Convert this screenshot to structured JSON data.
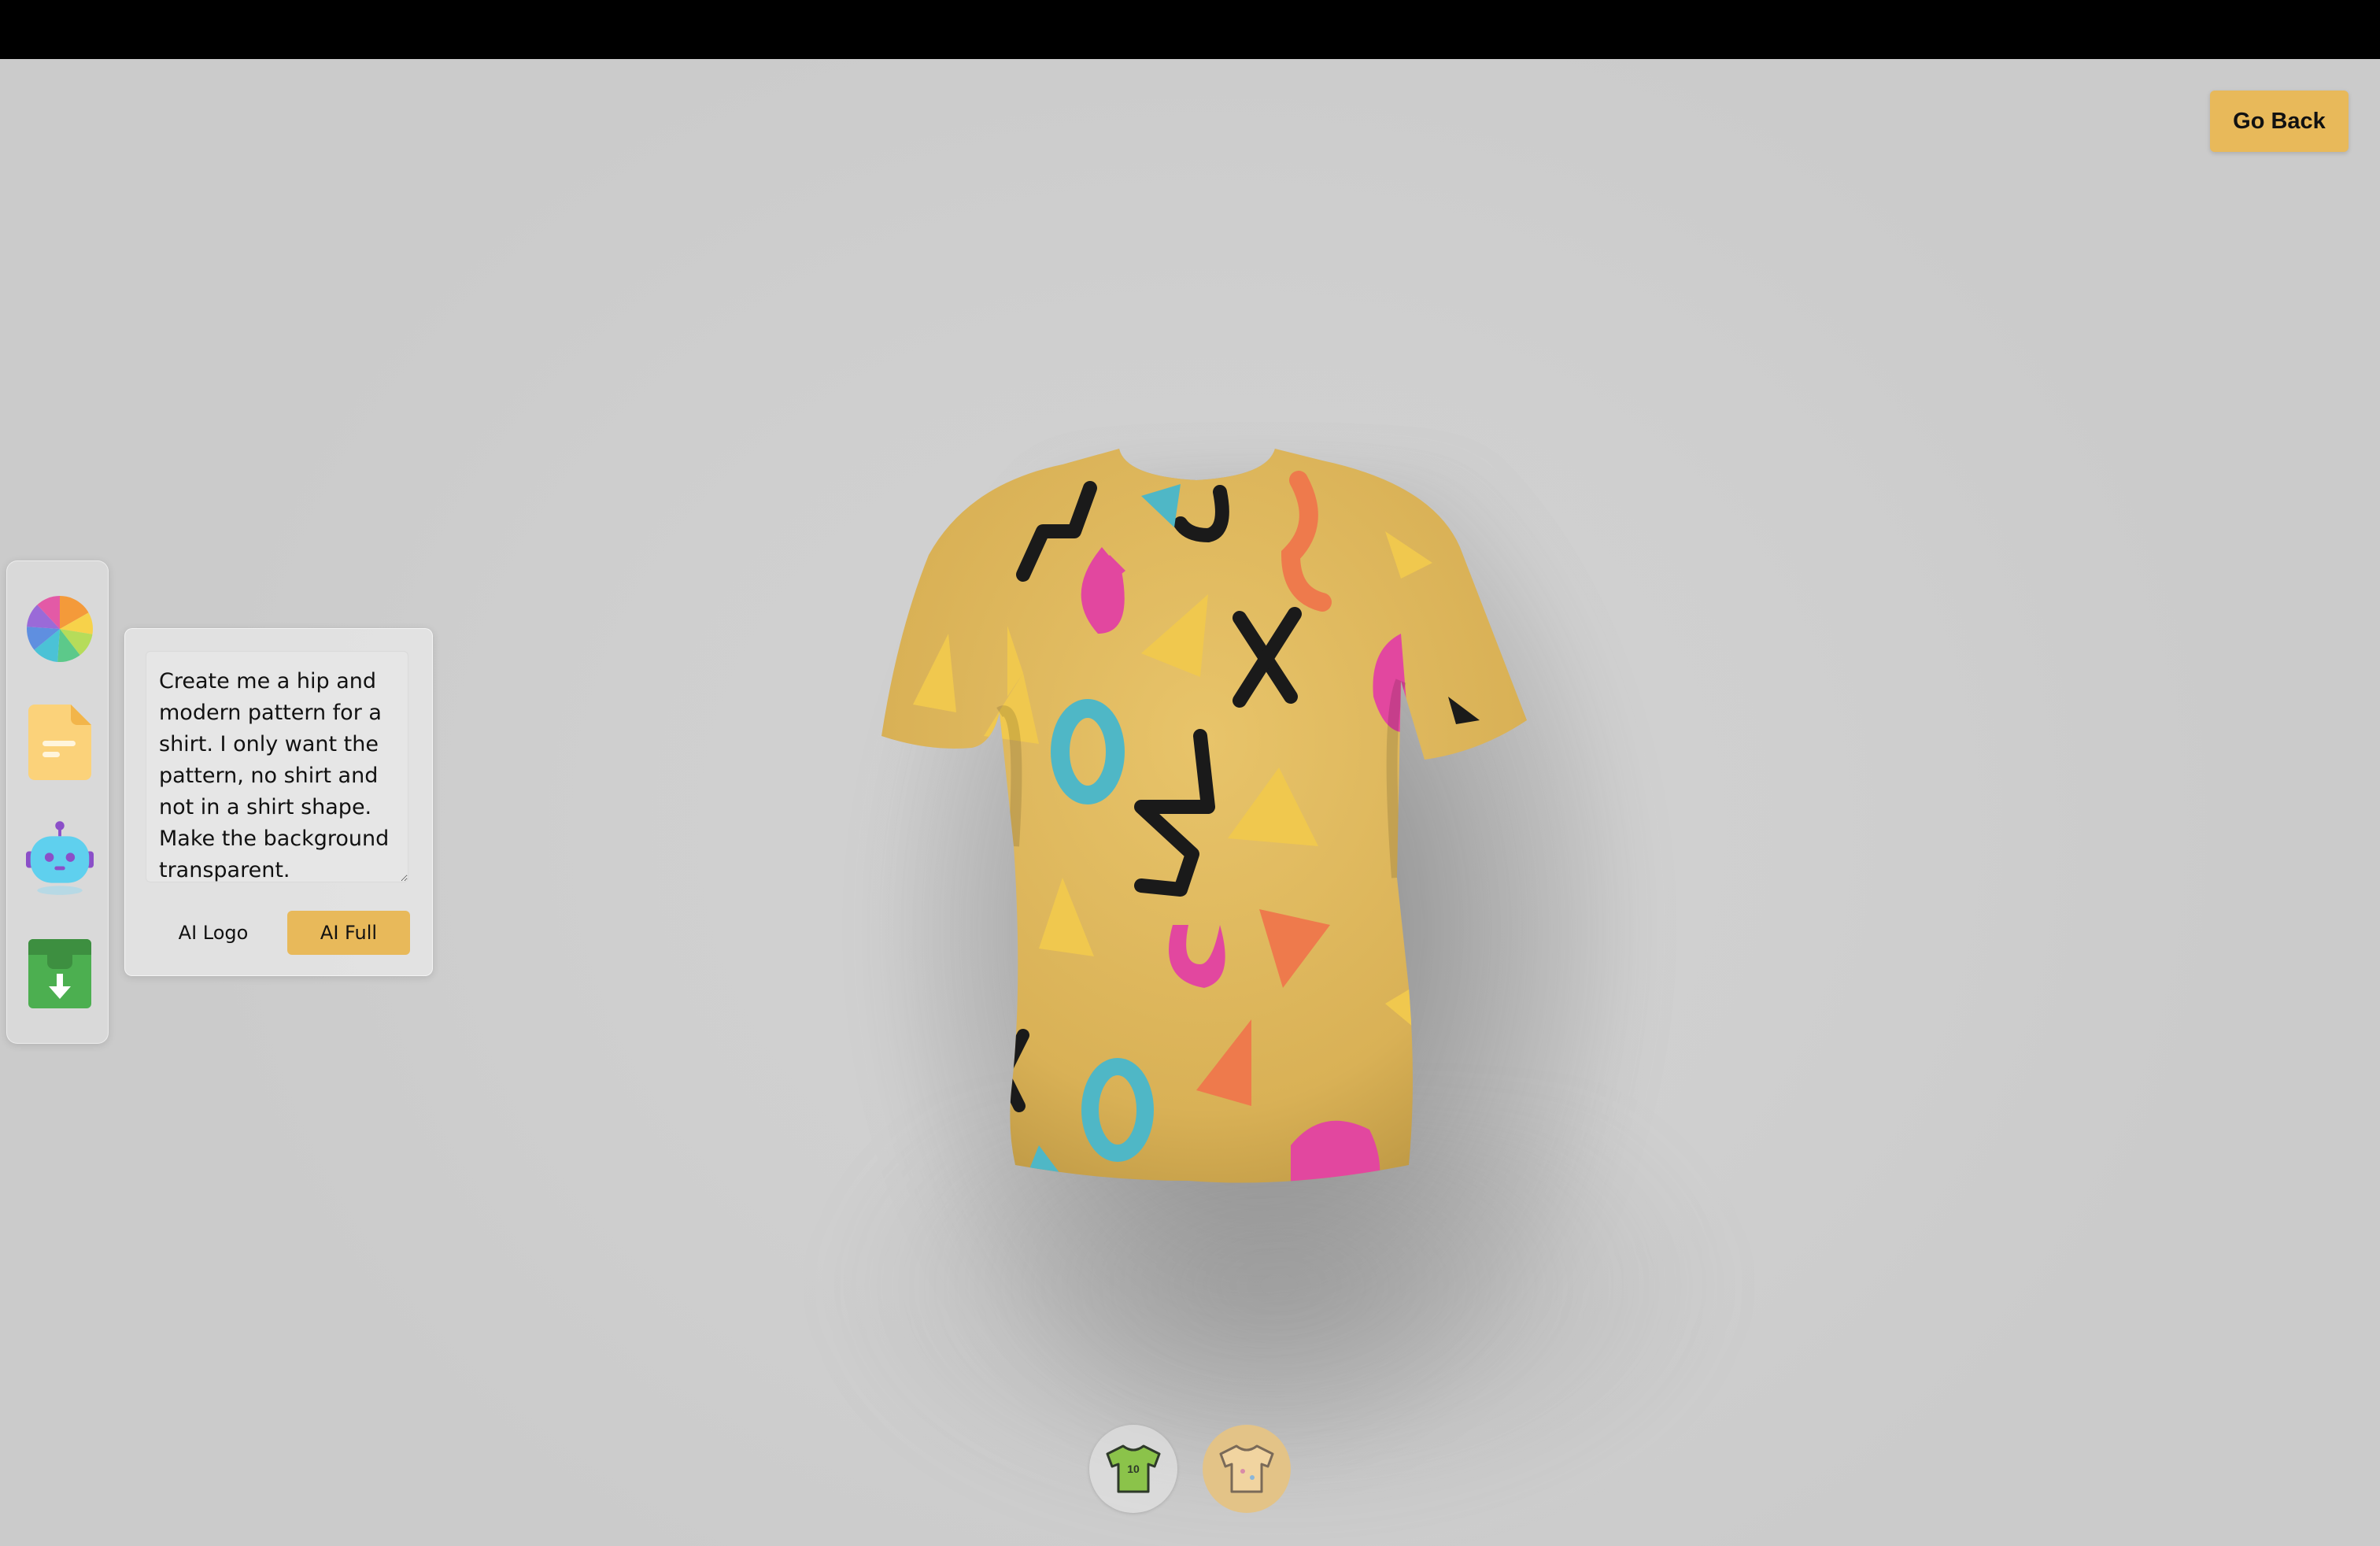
{
  "header": {
    "go_back_label": "Go Back"
  },
  "sidebar": {
    "items": [
      {
        "name": "color-picker",
        "icon": "color-wheel-icon"
      },
      {
        "name": "file-picker",
        "icon": "file-icon"
      },
      {
        "name": "ai-picker",
        "icon": "robot-icon"
      },
      {
        "name": "download",
        "icon": "download-box-icon"
      }
    ]
  },
  "ai_panel": {
    "prompt_value": "Create me a hip and modern pattern for a shirt. I only want the pattern, no shirt and not in a shirt shape. Make the background transparent.",
    "ai_logo_label": "AI Logo",
    "ai_full_label": "AI Full"
  },
  "shirt": {
    "base_color": "#e2b95c"
  },
  "filter_tabs": [
    {
      "name": "logo-shirt",
      "icon": "shirt-logo-icon",
      "shirt_number": "10",
      "active": false
    },
    {
      "name": "stylish-shirt",
      "icon": "shirt-full-icon",
      "active": true
    }
  ],
  "colors": {
    "accent": "#e8b95a"
  }
}
